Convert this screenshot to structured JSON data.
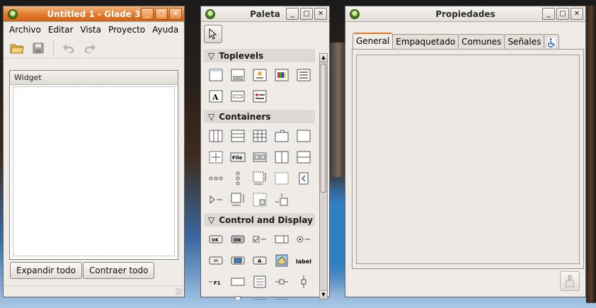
{
  "main_window": {
    "title": "Untitled 1 - Glade 3",
    "menu": [
      {
        "label": "Archivo"
      },
      {
        "label": "Editar"
      },
      {
        "label": "Vista"
      },
      {
        "label": "Proyecto"
      },
      {
        "label": "Ayuda"
      }
    ],
    "tree_header": "Widget",
    "expand_button": "Expandir todo",
    "collapse_button": "Contraer todo"
  },
  "palette_window": {
    "title": "Paleta",
    "groups": [
      {
        "label": "Toplevels"
      },
      {
        "label": "Containers"
      },
      {
        "label": "Control and Display"
      }
    ],
    "item_texts": {
      "file": "File",
      "label": "label",
      "ok": "OK",
      "on": "ON",
      "text_a": "A",
      "f1": "F1"
    }
  },
  "properties_window": {
    "title": "Propiedades",
    "tabs": [
      {
        "label": "General"
      },
      {
        "label": "Empaquetado"
      },
      {
        "label": "Comunes"
      },
      {
        "label": "Señales"
      }
    ],
    "selected_tab": "General"
  },
  "colors": {
    "active_title": "#e27a2b",
    "window_bg": "#efebe7"
  }
}
